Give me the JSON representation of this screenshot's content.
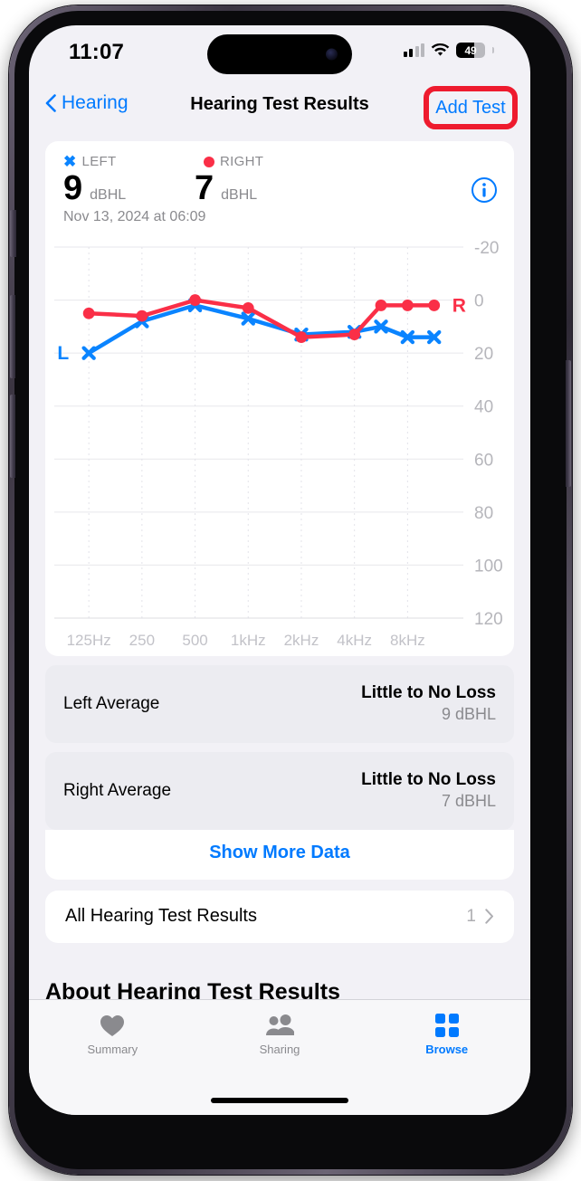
{
  "status_bar": {
    "time": "11:07",
    "battery_percent": "49",
    "battery_level": 61,
    "cellular_icon": "cellular-bars-icon",
    "wifi_icon": "wifi-icon",
    "battery_icon": "battery-icon"
  },
  "nav": {
    "back_label": "Hearing",
    "title": "Hearing Test Results",
    "action_label": "Add Test",
    "highlight_color": "#ee1b2e",
    "accent_color": "#007aff"
  },
  "summary": {
    "left_legend": "LEFT",
    "right_legend": "RIGHT",
    "left_value": "9",
    "left_unit": "dBHL",
    "right_value": "7",
    "right_unit": "dBHL",
    "date": "Nov 13, 2024 at 06:09",
    "info_icon": "info-circle-icon",
    "left_color": "#0a84ff",
    "right_color": "#fa2f47"
  },
  "chart_data": {
    "type": "line",
    "title": "",
    "xlabel": "",
    "ylabel": "dBHL",
    "categories": [
      "125Hz",
      "250",
      "500",
      "1kHz",
      "2kHz",
      "4kHz",
      "8kHz"
    ],
    "x_positions": [
      1,
      2,
      3,
      4,
      5,
      6,
      7
    ],
    "x_tick_labels": [
      "125Hz",
      "250",
      "500",
      "1kHz",
      "2kHz",
      "4kHz",
      "8kHz"
    ],
    "y_tick_labels": [
      "-20",
      "0",
      "20",
      "40",
      "60",
      "80",
      "100",
      "120"
    ],
    "y_ticks": [
      -20,
      0,
      20,
      40,
      60,
      80,
      100,
      120
    ],
    "ylim": [
      -20,
      120
    ],
    "y_inverted": true,
    "grid": true,
    "legend_position": "inline-endpoint-labels",
    "series": [
      {
        "name": "L",
        "label": "L",
        "color": "#0a84ff",
        "marker": "x",
        "x": [
          1,
          2,
          3,
          4,
          5,
          6,
          6.5,
          7,
          7.5
        ],
        "values": [
          20,
          8,
          2,
          7,
          13,
          12,
          10,
          14,
          14
        ]
      },
      {
        "name": "R",
        "label": "R",
        "color": "#fa2f47",
        "marker": "circle",
        "x": [
          1,
          2,
          3,
          4,
          5,
          6,
          6.5,
          7,
          7.5
        ],
        "values": [
          5,
          6,
          0,
          3,
          14,
          13,
          2,
          2,
          2
        ]
      }
    ]
  },
  "averages": [
    {
      "label": "Left Average",
      "status": "Little to No Loss",
      "value": "9 dBHL"
    },
    {
      "label": "Right Average",
      "status": "Little to No Loss",
      "value": "7 dBHL"
    }
  ],
  "show_more": "Show More Data",
  "all_results": {
    "label": "All Hearing Test Results",
    "count": "1",
    "chevron_icon": "chevron-right-icon"
  },
  "about_heading": "About Hearing Test Results",
  "tabs": [
    {
      "label": "Summary",
      "icon": "heart-icon",
      "active": false
    },
    {
      "label": "Sharing",
      "icon": "people-icon",
      "active": false
    },
    {
      "label": "Browse",
      "icon": "grid-icon",
      "active": true
    }
  ]
}
